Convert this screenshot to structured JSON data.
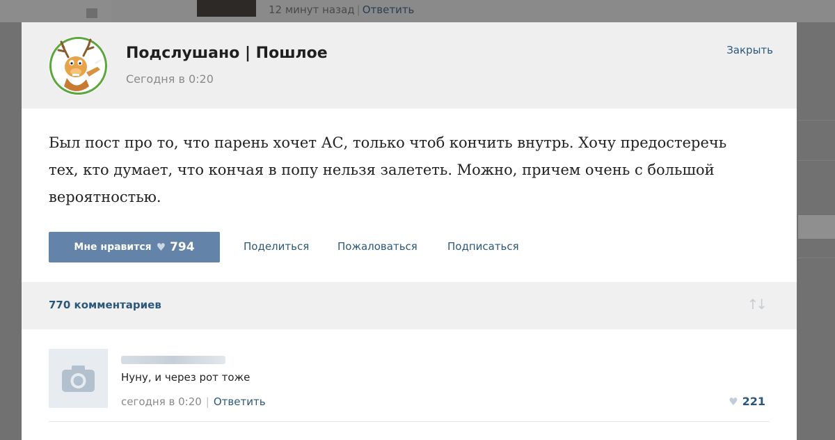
{
  "background": {
    "meta_time": "12 минут назад",
    "meta_reply": "Ответить"
  },
  "post": {
    "group_name": "Подслушано | Пошлое",
    "date": "Сегодня в 0:20",
    "close_label": "Закрыть",
    "text": "Был пост про то, что парень хочет АС, только чтоб кончить внутрь. Хочу предостеречь тех, кто думает, что кончая в попу нельзя залететь. Можно, причем очень с большой вероятностью.",
    "like_label": "Мне нравится",
    "like_count": "794",
    "actions": [
      "Поделиться",
      "Пожаловаться",
      "Подписаться"
    ]
  },
  "comments": {
    "count_label": "770 комментариев",
    "items": [
      {
        "text": "Нуну, и через рот тоже",
        "time": "сегодня в 0:20",
        "reply": "Ответить",
        "likes": "221"
      }
    ]
  },
  "colors": {
    "accent": "#2b587a",
    "button": "#6383a8",
    "overlay": "#717171"
  },
  "icons": [
    "mail-icon",
    "deer-avatar-icon",
    "heart-icon",
    "sort-icon",
    "camera-icon"
  ]
}
